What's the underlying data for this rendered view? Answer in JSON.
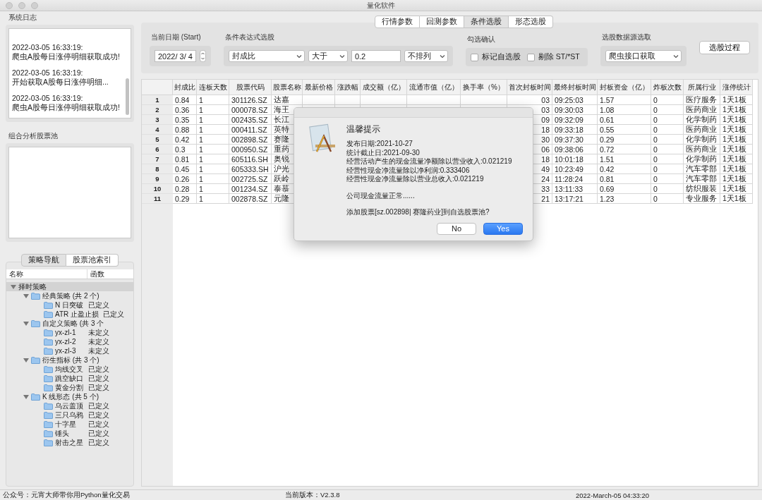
{
  "window": {
    "title": "量化软件"
  },
  "system_log": {
    "title": "系统日志",
    "entries": [
      {
        "time": "2022-03-05 16:33:19:",
        "message": "爬虫A股每日涨停明细获取成功!"
      },
      {
        "time": "2022-03-05 16:33:19:",
        "message": "开始获取A股每日涨停明细..."
      },
      {
        "time": "2022-03-05 16:33:19:",
        "message": "爬虫A股每日涨停明细获取成功!"
      }
    ]
  },
  "pool": {
    "title": "组合分析股票池"
  },
  "nav_tabs": [
    {
      "label": "策略导航",
      "selected": true
    },
    {
      "label": "股票池索引",
      "selected": false
    }
  ],
  "tree": {
    "columns": [
      "名称",
      "函数"
    ],
    "items": [
      {
        "name": "择时策略",
        "selected": true,
        "expanded": true,
        "children": [
          {
            "name": "经典策略 (共 2 个)",
            "selected": false,
            "expanded": true,
            "children": [
              {
                "name": "N 日突破",
                "function": "已定义",
                "selected": false
              },
              {
                "name": "ATR 止盈止损",
                "function": "已定义",
                "selected": false
              }
            ]
          },
          {
            "name": "自定义策略 (共 3 个",
            "selected": false,
            "expanded": true,
            "children": [
              {
                "name": "yx-zl-1",
                "function": "未定义",
                "selected": false
              },
              {
                "name": "yx-zl-2",
                "function": "未定义",
                "selected": false
              },
              {
                "name": "yx-zl-3",
                "function": "未定义",
                "selected": false
              }
            ]
          },
          {
            "name": "衍生指标 (共 3 个)",
            "selected": false,
            "expanded": true,
            "children": [
              {
                "name": "均线交叉",
                "function": "已定义",
                "selected": false
              },
              {
                "name": "跳空缺口",
                "function": "已定义",
                "selected": false
              },
              {
                "name": "黄金分割",
                "function": "已定义",
                "selected": false
              }
            ]
          },
          {
            "name": "K 线形态 (共 5 个)",
            "selected": false,
            "expanded": true,
            "children": [
              {
                "name": "乌云盖顶",
                "function": "已定义",
                "selected": false
              },
              {
                "name": "三只乌鸦",
                "function": "已定义",
                "selected": false
              },
              {
                "name": "十字星",
                "function": "已定义",
                "selected": false
              },
              {
                "name": "锤头",
                "function": "已定义",
                "selected": false
              },
              {
                "name": "射击之星",
                "function": "已定义",
                "selected": false
              }
            ]
          }
        ]
      }
    ]
  },
  "top_tabs": [
    {
      "label": "行情参数",
      "selected": false
    },
    {
      "label": "回测参数",
      "selected": false
    },
    {
      "label": "条件选股",
      "selected": true
    },
    {
      "label": "形态选股",
      "selected": false
    }
  ],
  "date_group": {
    "title": "当前日期 (Start)",
    "value": "2022/ 3/ 4"
  },
  "condition_group": {
    "title": "条件表达式选股",
    "field": "封成比",
    "operator": "大于",
    "threshold": "0.2",
    "sort": "不排列"
  },
  "confirm_group": {
    "title": "勾选确认",
    "checkboxes": [
      {
        "label": "标记自选股",
        "checked": false
      },
      {
        "label": "剔除 ST/*ST",
        "checked": false
      }
    ]
  },
  "source_group": {
    "title": "选股数据源选取",
    "value": "爬虫接口获取"
  },
  "process_button": "选股过程",
  "table": {
    "columns": [
      "封成比",
      "连板天数",
      "股票代码",
      "股票名称",
      "最新价格",
      "涨跌幅",
      "成交额（亿）",
      "流通市值（亿）",
      "换手率（%）",
      "首次封板时间",
      "最终封板时间",
      "封板资金（亿）",
      "炸板次数",
      "所属行业",
      "涨停统计"
    ],
    "rows": [
      {
        "index": "1",
        "seal_ratio": "0.84",
        "streak_days": "1",
        "code": "301126.SZ",
        "name": "达嘉",
        "first_seal_time": "03",
        "last_seal_time": "09:25:03",
        "seal_funds": "1.57",
        "break_count": "0",
        "industry": "医疗服务",
        "limit_up_stats": "1天1板"
      },
      {
        "index": "2",
        "seal_ratio": "0.36",
        "streak_days": "1",
        "code": "000078.SZ",
        "name": "海王",
        "first_seal_time": "03",
        "last_seal_time": "09:30:03",
        "seal_funds": "1.08",
        "break_count": "0",
        "industry": "医药商业",
        "limit_up_stats": "1天1板"
      },
      {
        "index": "3",
        "seal_ratio": "0.35",
        "streak_days": "1",
        "code": "002435.SZ",
        "name": "长江",
        "first_seal_time": "09",
        "last_seal_time": "09:32:09",
        "seal_funds": "0.61",
        "break_count": "0",
        "industry": "化学制药",
        "limit_up_stats": "1天1板"
      },
      {
        "index": "4",
        "seal_ratio": "0.88",
        "streak_days": "1",
        "code": "000411.SZ",
        "name": "英特",
        "first_seal_time": "18",
        "last_seal_time": "09:33:18",
        "seal_funds": "0.55",
        "break_count": "0",
        "industry": "医药商业",
        "limit_up_stats": "1天1板"
      },
      {
        "index": "5",
        "seal_ratio": "0.42",
        "streak_days": "1",
        "code": "002898.SZ",
        "name": "赛隆",
        "first_seal_time": "30",
        "last_seal_time": "09:37:30",
        "seal_funds": "0.29",
        "break_count": "0",
        "industry": "化学制药",
        "limit_up_stats": "1天1板"
      },
      {
        "index": "6",
        "seal_ratio": "0.3",
        "streak_days": "1",
        "code": "000950.SZ",
        "name": "重药",
        "first_seal_time": "06",
        "last_seal_time": "09:38:06",
        "seal_funds": "0.72",
        "break_count": "0",
        "industry": "医药商业",
        "limit_up_stats": "1天1板"
      },
      {
        "index": "7",
        "seal_ratio": "0.81",
        "streak_days": "1",
        "code": "605116.SH",
        "name": "奥锐",
        "first_seal_time": "18",
        "last_seal_time": "10:01:18",
        "seal_funds": "1.51",
        "break_count": "0",
        "industry": "化学制药",
        "limit_up_stats": "1天1板"
      },
      {
        "index": "8",
        "seal_ratio": "0.45",
        "streak_days": "1",
        "code": "605333.SH",
        "name": "沪光",
        "first_seal_time": "49",
        "last_seal_time": "10:23:49",
        "seal_funds": "0.42",
        "break_count": "0",
        "industry": "汽车零部",
        "limit_up_stats": "1天1板"
      },
      {
        "index": "9",
        "seal_ratio": "0.26",
        "streak_days": "1",
        "code": "002725.SZ",
        "name": "跃岭",
        "first_seal_time": "24",
        "last_seal_time": "11:28:24",
        "seal_funds": "0.81",
        "break_count": "0",
        "industry": "汽车零部",
        "limit_up_stats": "1天1板"
      },
      {
        "index": "10",
        "seal_ratio": "0.28",
        "streak_days": "1",
        "code": "001234.SZ",
        "name": "泰慕",
        "first_seal_time": "33",
        "last_seal_time": "13:11:33",
        "seal_funds": "0.69",
        "break_count": "0",
        "industry": "纺织服装",
        "limit_up_stats": "1天1板"
      },
      {
        "index": "11",
        "seal_ratio": "0.29",
        "streak_days": "1",
        "code": "002878.SZ",
        "name": "元隆",
        "first_seal_time": "21",
        "last_seal_time": "13:17:21",
        "seal_funds": "1.23",
        "break_count": "0",
        "industry": "专业服务",
        "limit_up_stats": "1天1板"
      }
    ]
  },
  "dialog": {
    "title": "温馨提示",
    "lines": [
      "发布日期:2021-10-27",
      "统计截止日:2021-09-30",
      "经营活动产生的现金流量净额除以营业收入:0.021219",
      "经营性现金净流量除以净利润:0.333406",
      "经营性现金净流量除以营业总收入:0.021219"
    ],
    "summary": "公司现金流量正常......",
    "question": "添加股票[sz.002898| 赛隆药业]到自选股票池?",
    "buttons": [
      {
        "label": "No",
        "default": false
      },
      {
        "label": "Yes",
        "default": true
      }
    ]
  },
  "status_bar": {
    "account": "公众号：元宵大师带你用Python量化交易",
    "version": "当前版本：V2.3.8",
    "datetime": "2022-March-05 04:33:20"
  }
}
